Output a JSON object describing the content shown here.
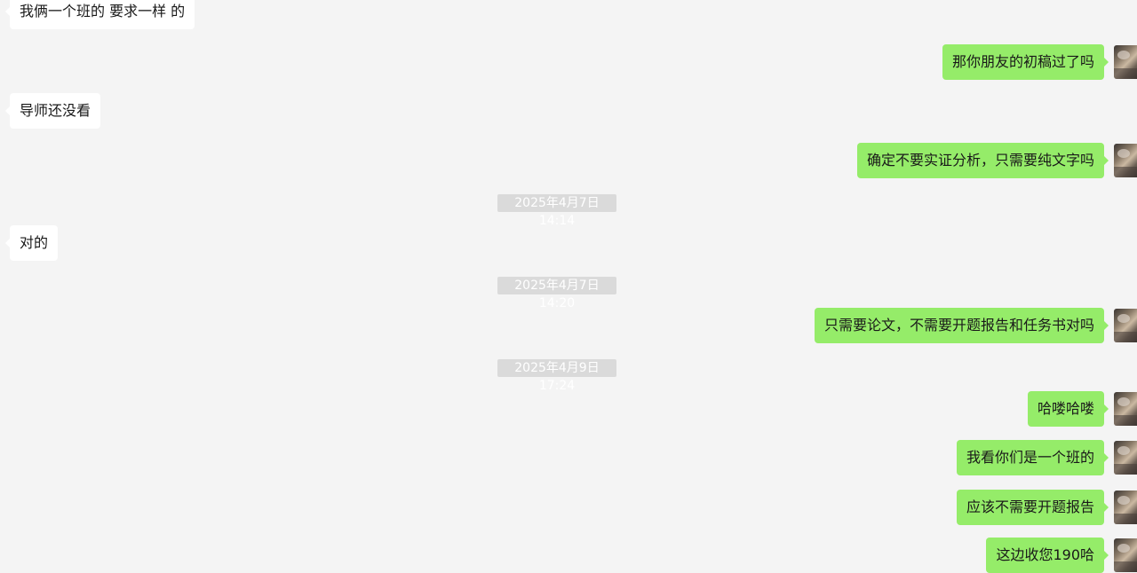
{
  "messages": [
    {
      "side": "in",
      "text": "我俩一个班的 要求一样 的"
    },
    {
      "side": "out",
      "text": "那你朋友的初稿过了吗"
    },
    {
      "side": "in",
      "text": "导师还没看"
    },
    {
      "side": "out",
      "text": "确定不要实证分析，只需要纯文字吗"
    },
    {
      "side": "ts",
      "text": "2025年4月7日 14:14"
    },
    {
      "side": "in",
      "text": "对的"
    },
    {
      "side": "ts",
      "text": "2025年4月7日 14:20"
    },
    {
      "side": "out",
      "text": "只需要论文，不需要开题报告和任务书对吗"
    },
    {
      "side": "ts",
      "text": "2025年4月9日 17:24"
    },
    {
      "side": "out",
      "text": "哈喽哈喽"
    },
    {
      "side": "out",
      "text": "我看你们是一个班的"
    },
    {
      "side": "out",
      "text": "应该不需要开题报告"
    },
    {
      "side": "out",
      "text": "这边收您190哈"
    }
  ],
  "colors": {
    "background": "#f4f4f4",
    "incoming_bubble": "#ffffff",
    "outgoing_bubble": "#95ec69",
    "timestamp_bg": "#dadada",
    "timestamp_text": "#ffffff"
  }
}
